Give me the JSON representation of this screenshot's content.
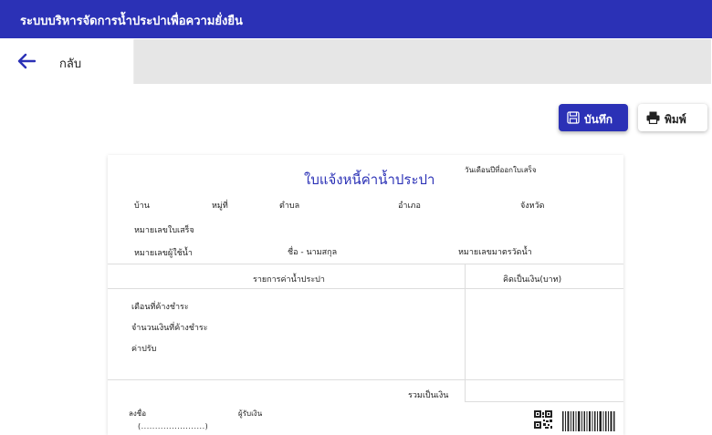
{
  "header": {
    "title": "ระบบบริหารจัดการน้ำประปาเพื่อความยั่งยืน"
  },
  "nav": {
    "back_label": "กลับ",
    "back_icon": "arrow-left-icon"
  },
  "toolbar": {
    "save_label": "บันทึก",
    "save_icon": "save-icon",
    "print_label": "พิมพ์",
    "print_icon": "printer-icon"
  },
  "invoice": {
    "title": "ใบแจ้งหนี้ค่าน้ำประปา",
    "issue_date_label": "วันเดือนปีที่ออกใบเสร็จ",
    "address": {
      "house": "บ้าน",
      "moo": "หมู่ที่",
      "tambon": "ตำบล",
      "amphoe": "อำเภอ",
      "province": "จังหวัด"
    },
    "receipt_no_label": "หมายเลขใบเสร็จ",
    "user_no_label": "หมายเลขผู้ใช้น้ำ",
    "name_label": "ชื่อ - นามสกุล",
    "meter_no_label": "หมายเลขมาตรวัดน้ำ",
    "table": {
      "col_items": "รายการค่าน้ำประปา",
      "col_amount": "คิดเป็นเงิน(บาท)",
      "rows": [
        "เดือนที่ค้างชำระ",
        "จำนวนเงินที่ค้างชำระ",
        "ค่าปรับ"
      ],
      "total_label": "รวมเป็นเงิน"
    },
    "sign": {
      "sign_label": "ลงชื่อ",
      "receiver_label": "ผู้รับเงิน",
      "dots": "(.......................)"
    },
    "qr_icon": "qr-code-icon",
    "barcode_icon": "barcode-icon"
  }
}
